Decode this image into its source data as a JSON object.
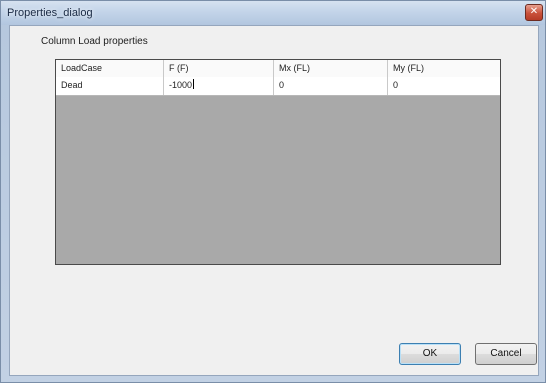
{
  "window": {
    "title": "Properties_dialog",
    "close_glyph": "✕"
  },
  "group": {
    "label": "Column Load properties"
  },
  "grid": {
    "columns": [
      "LoadCase",
      "F (F)",
      "Mx (FL)",
      "My (FL)"
    ],
    "rows": [
      {
        "load_case": "Dead",
        "f": "-1000",
        "mx": "0",
        "my": "0"
      }
    ]
  },
  "buttons": {
    "ok": "OK",
    "cancel": "Cancel"
  },
  "icons": {
    "close": "close-icon"
  },
  "colors": {
    "grid_empty_area": "#a9a9a9",
    "close_button": "#c9513b"
  }
}
